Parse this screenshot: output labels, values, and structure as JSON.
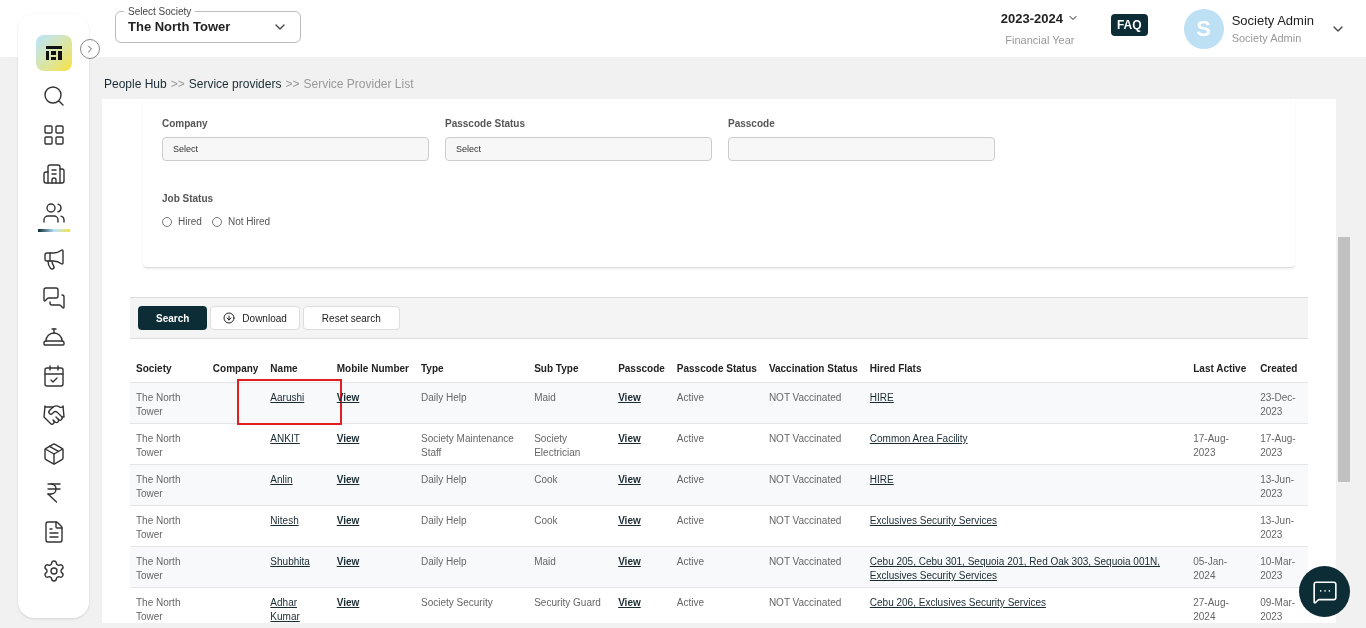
{
  "society_select": {
    "label": "Select Society",
    "value": "The North Tower"
  },
  "financial_year": {
    "value": "2023-2024",
    "caption": "Financial Year"
  },
  "faq": "FAQ",
  "user": {
    "initial": "S",
    "name": "Society Admin",
    "role": "Society Admin"
  },
  "sidebar": {
    "items": [
      {
        "kind": "logo",
        "selected": false
      },
      {
        "kind": "search",
        "selected": false
      },
      {
        "kind": "grid",
        "selected": false
      },
      {
        "kind": "building",
        "selected": false
      },
      {
        "kind": "people",
        "selected": true
      },
      {
        "kind": "megaphone",
        "selected": false
      },
      {
        "kind": "chat",
        "selected": false
      },
      {
        "kind": "desk",
        "selected": false
      },
      {
        "kind": "calendar",
        "selected": false
      },
      {
        "kind": "handshake",
        "selected": false
      },
      {
        "kind": "box",
        "selected": false
      },
      {
        "kind": "rupee",
        "selected": false
      },
      {
        "kind": "report",
        "selected": false
      },
      {
        "kind": "settings",
        "selected": false
      }
    ]
  },
  "breadcrumb": [
    {
      "kind": "link",
      "text": "People Hub",
      "current": false
    },
    {
      "kind": "separator",
      "text": ">>"
    },
    {
      "kind": "link",
      "text": "Service providers",
      "current": false
    },
    {
      "kind": "separator",
      "text": ">>"
    },
    {
      "kind": "link",
      "text": "Service Provider List",
      "current": true
    }
  ],
  "filters": {
    "fields": [
      {
        "label": "Company",
        "placeholder": "Select"
      },
      {
        "label": "Passcode Status",
        "placeholder": "Select"
      },
      {
        "label": "Passcode"
      }
    ],
    "job_status": {
      "label": "Job Status",
      "options": [
        {
          "label": "Hired",
          "checked": false
        },
        {
          "label": "Not Hired",
          "checked": false
        }
      ]
    }
  },
  "actions": [
    {
      "kind": "primary",
      "label": "Search"
    },
    {
      "kind": "download",
      "label": "Download"
    },
    {
      "kind": "plain",
      "label": "Reset search"
    }
  ],
  "table": {
    "columns": [
      "Society",
      "Company",
      "Name",
      "Mobile Number",
      "Type",
      "Sub Type",
      "Passcode",
      "Passcode Status",
      "Vaccination Status",
      "Hired Flats",
      "Last Active",
      "Created"
    ],
    "rows": [
      {
        "society": "The North Tower",
        "company": "",
        "name": "Aarushi",
        "mobile": "View",
        "type": "Daily Help",
        "sub_type": "Maid",
        "passcode": "View",
        "passcode_status": "Active",
        "vaccination": "NOT Vaccinated",
        "hired_flats": "HIRE",
        "last_active": "",
        "created": "23-Dec-2023",
        "highlighted": true
      },
      {
        "society": "The North Tower",
        "company": "",
        "name": "ANKIT",
        "mobile": "View",
        "type": "Society Maintenance Staff",
        "sub_type": "Society Electrician",
        "passcode": "View",
        "passcode_status": "Active",
        "vaccination": "NOT Vaccinated",
        "hired_flats": "Common Area Facility",
        "last_active": "17-Aug-2023",
        "created": "17-Aug-2023",
        "highlighted": false
      },
      {
        "society": "The North Tower",
        "company": "",
        "name": "Anlin",
        "mobile": "View",
        "type": "Daily Help",
        "sub_type": "Cook",
        "passcode": "View",
        "passcode_status": "Active",
        "vaccination": "NOT Vaccinated",
        "hired_flats": "HIRE",
        "last_active": "",
        "created": "13-Jun-2023",
        "highlighted": false
      },
      {
        "society": "The North Tower",
        "company": "",
        "name": "Nitesh",
        "mobile": "View",
        "type": "Daily Help",
        "sub_type": "Cook",
        "passcode": "View",
        "passcode_status": "Active",
        "vaccination": "NOT Vaccinated",
        "hired_flats": "Exclusives Security Services",
        "last_active": "",
        "created": "13-Jun-2023",
        "highlighted": false
      },
      {
        "society": "The North Tower",
        "company": "",
        "name": "Shubhita",
        "mobile": "View",
        "type": "Daily Help",
        "sub_type": "Maid",
        "passcode": "View",
        "passcode_status": "Active",
        "vaccination": "NOT Vaccinated",
        "hired_flats": "Cebu 205, Cebu 301, Sequoia 201, Red Oak 303, Sequoia 001N, Exclusives Security Services",
        "last_active": "05-Jan-2024",
        "created": "10-Mar-2023",
        "highlighted": false
      },
      {
        "society": "The North Tower",
        "company": "",
        "name": "Adhar Kumar",
        "mobile": "View",
        "type": "Society Security",
        "sub_type": "Security Guard",
        "passcode": "View",
        "passcode_status": "Active",
        "vaccination": "NOT Vaccinated",
        "hired_flats": "Cebu 206, Exclusives Security Services",
        "last_active": "27-Aug-2024",
        "created": "09-Mar-2023",
        "highlighted": false
      }
    ]
  }
}
